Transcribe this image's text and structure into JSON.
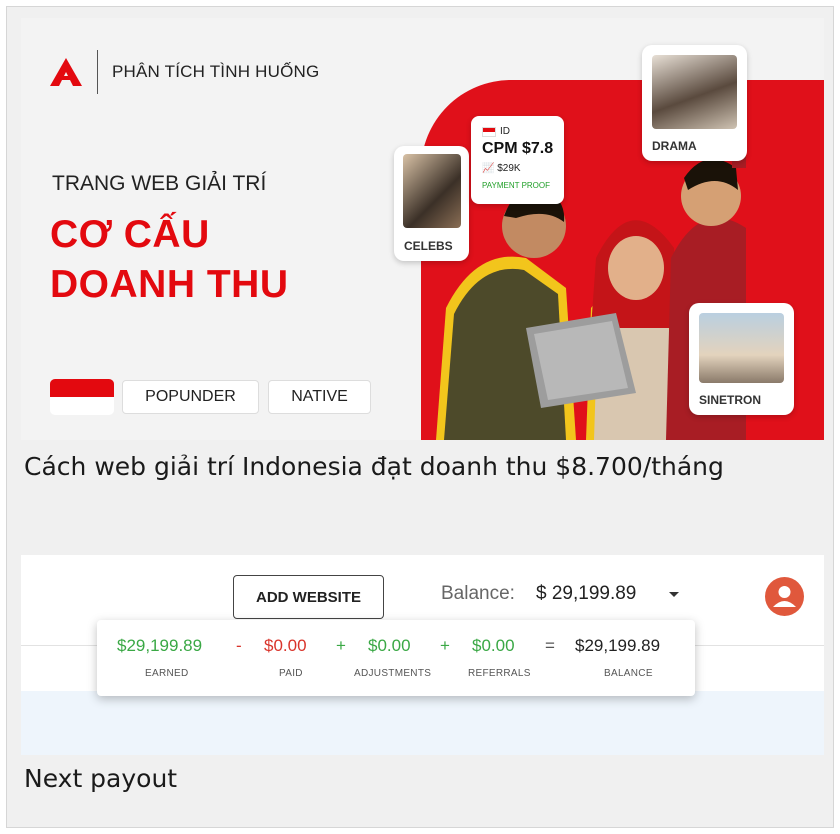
{
  "colors": {
    "brand_red": "#e3090f",
    "green": "#3aa845",
    "red": "#d9342b",
    "avatar": "#e0583c"
  },
  "banner": {
    "logo_icon": "adsterra-a-icon",
    "section_label": "PHÂN TÍCH TÌNH HUỐNG",
    "kicker": "TRANG WEB GIẢI TRÍ",
    "headline_line1": "CƠ CẤU",
    "headline_line2": "DOANH THU",
    "flag_icon": "indonesia-flag-icon",
    "tags": [
      "POPUNDER",
      "NATIVE"
    ],
    "cards": {
      "celebs": "CELEBS",
      "drama": "DRAMA",
      "sinetron": "SINETRON"
    },
    "cpm_card": {
      "country": "ID",
      "cpm": "CPM $7.8",
      "amount": "$29K",
      "proof": "PAYMENT PROOF"
    }
  },
  "caption_top": "Cách web giải trí Indonesia đạt doanh thu $8.700/tháng",
  "dashboard": {
    "add_website_label": "ADD WEBSITE",
    "balance_label": "Balance:",
    "balance_value": "$ 29,199.89",
    "summary": {
      "earned_value": "$29,199.89",
      "earned_label": "EARNED",
      "op_minus": "-",
      "paid_value": "$0.00",
      "paid_label": "PAID",
      "op_plus1": "+",
      "adjustments_value": "$0.00",
      "adjustments_label": "ADJUSTMENTS",
      "op_plus2": "+",
      "referrals_value": "$0.00",
      "referrals_label": "REFERRALS",
      "op_equals": "=",
      "balance_value": "$29,199.89",
      "balance_label": "BALANCE"
    }
  },
  "caption_bottom": "Next payout"
}
